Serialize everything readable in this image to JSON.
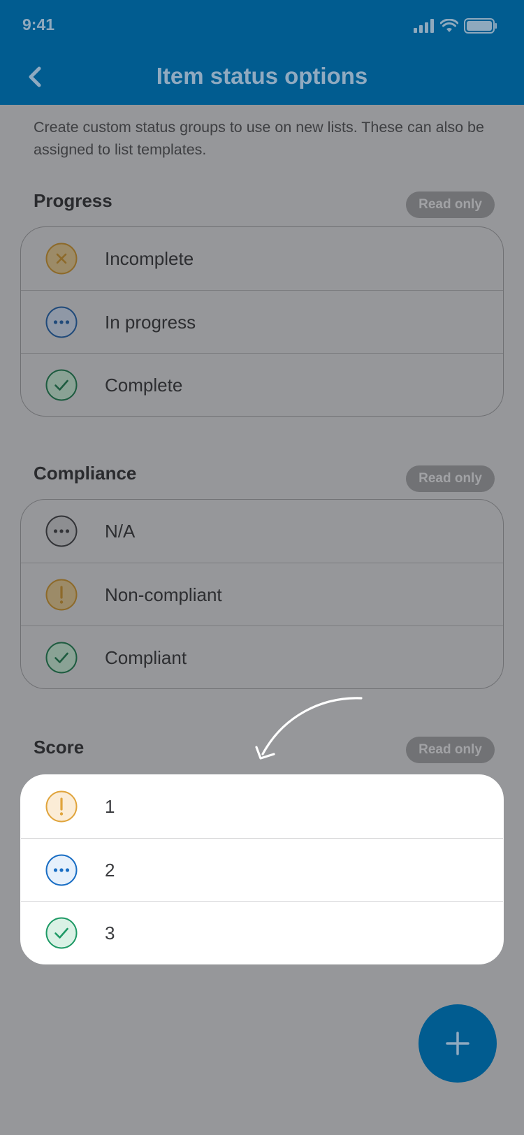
{
  "status_bar": {
    "time": "9:41"
  },
  "nav": {
    "title": "Item status options"
  },
  "intro": "Create custom status groups to use on new lists. These can also be assigned to list templates.",
  "colors": {
    "primary": "#015c90",
    "overlay_bg": "#96979a",
    "badge_bg": "#717275",
    "orange": "#e0a43c",
    "blue": "#1a6ec4",
    "green": "#1f9a66",
    "gray": "#55565a"
  },
  "sections": [
    {
      "title": "Progress",
      "badge": "Read only",
      "items": [
        {
          "label": "Incomplete",
          "icon": "x-circle-icon"
        },
        {
          "label": "In progress",
          "icon": "dots-circle-icon"
        },
        {
          "label": "Complete",
          "icon": "check-circle-icon"
        }
      ]
    },
    {
      "title": "Compliance",
      "badge": "Read only",
      "items": [
        {
          "label": "N/A",
          "icon": "dots-circle-icon"
        },
        {
          "label": "Non-compliant",
          "icon": "exclamation-circle-icon"
        },
        {
          "label": "Compliant",
          "icon": "check-circle-icon"
        }
      ]
    },
    {
      "title": "Score",
      "badge": "Read only",
      "items": [
        {
          "label": "1",
          "icon": "exclamation-circle-icon"
        },
        {
          "label": "2",
          "icon": "dots-circle-icon"
        },
        {
          "label": "3",
          "icon": "check-circle-icon"
        }
      ]
    }
  ],
  "fab": {
    "icon": "plus-icon"
  }
}
